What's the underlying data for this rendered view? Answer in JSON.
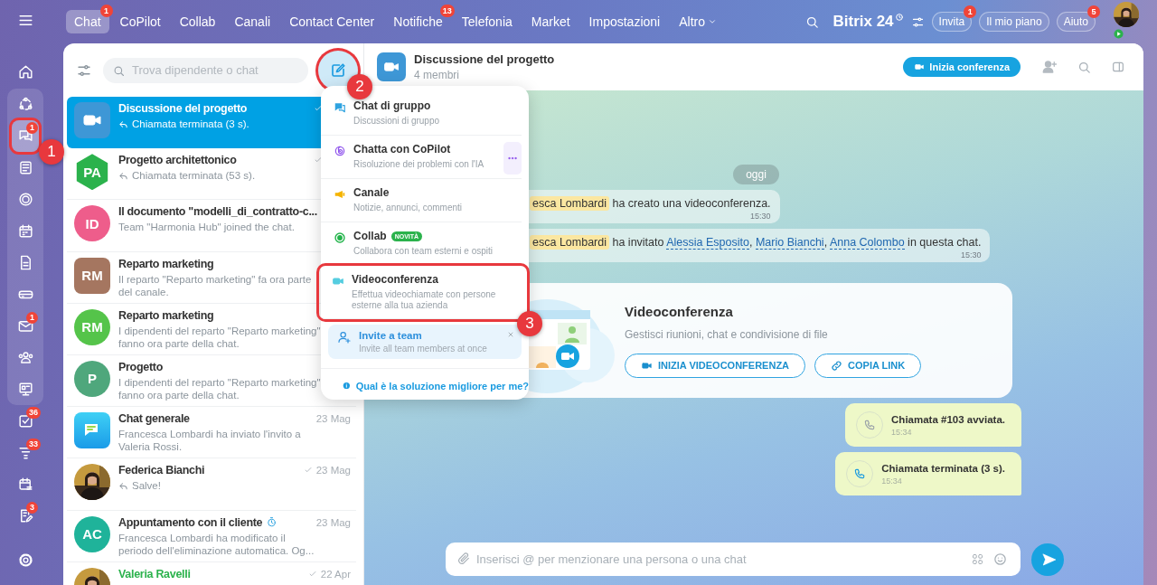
{
  "rail": [
    {
      "selected": false
    },
    {
      "selected": false
    },
    {
      "selected": false
    },
    {
      "selected": true,
      "badge": "1"
    },
    {
      "selected": false
    },
    {
      "selected": false
    },
    {
      "selected": false
    },
    {
      "selected": false
    },
    {
      "selected": false
    },
    {
      "selected": false,
      "badge": "1"
    },
    {
      "selected": false
    },
    {
      "selected": false
    },
    {
      "selected": false,
      "badge": "36"
    },
    {
      "selected": false,
      "badge": "33"
    },
    {
      "selected": false
    },
    {
      "selected": false,
      "badge": "3"
    },
    {
      "selected": false
    }
  ],
  "top_nav": {
    "tabs": [
      {
        "label": "Chat",
        "selected": true,
        "badge": "1"
      },
      {
        "label": "CoPilot",
        "selected": false
      },
      {
        "label": "Collab",
        "selected": false
      },
      {
        "label": "Canali",
        "selected": false
      },
      {
        "label": "Contact Center",
        "selected": false
      },
      {
        "label": "Notifiche",
        "selected": false,
        "badge": "13"
      },
      {
        "label": "Telefonia",
        "selected": false
      },
      {
        "label": "Market",
        "selected": false
      },
      {
        "label": "Impostazioni",
        "selected": false
      },
      {
        "label": "Altro",
        "selected": false,
        "dropdown": true
      }
    ],
    "logo": "Bitrix 24",
    "buttons": [
      {
        "label": "Invita",
        "badge": "1"
      },
      {
        "label": "Il mio piano"
      },
      {
        "label": "Aiuto",
        "badge": "5"
      }
    ]
  },
  "chat_list": {
    "search_placeholder": "Trova dipendente o chat",
    "chats": [
      {
        "title": "Discussione del progetto",
        "subtitle": "Chiamata terminata (3 s).",
        "reply": true,
        "read": true,
        "selected": true,
        "avatar": {
          "kind": "video"
        }
      },
      {
        "title": "Progetto architettonico",
        "subtitle": "Chiamata terminata (53 s).",
        "reply": true,
        "read": true,
        "selected": false,
        "avatar": {
          "kind": "hexagon",
          "initials": "PA",
          "color": "#2bb24c"
        }
      },
      {
        "title": "Il documento \"modelli_di_contratto-c...",
        "subtitle": "Team \"Harmonia Hub\" joined the chat.",
        "reply": false,
        "read": false,
        "selected": false,
        "avatar": {
          "kind": "circle",
          "initials": "ID",
          "color": "#ee5d8b"
        }
      },
      {
        "title": "Reparto marketing",
        "subtitle": "Il reparto \"Reparto marketing\" fa ora parte del canale.",
        "reply": false,
        "read": false,
        "selected": false,
        "avatar": {
          "kind": "square",
          "initials": "RM",
          "color": "#a57660"
        }
      },
      {
        "title": "Reparto marketing",
        "subtitle": "I dipendenti del reparto \"Reparto marketing\" fanno ora parte della chat.",
        "reply": false,
        "read": false,
        "selected": false,
        "avatar": {
          "kind": "circle",
          "initials": "RM",
          "color": "#55c44a"
        }
      },
      {
        "title": "Progetto",
        "subtitle": "I dipendenti del reparto \"Reparto marketing\" fanno ora parte della chat.",
        "reply": false,
        "read": false,
        "selected": false,
        "avatar": {
          "kind": "circle",
          "initials": "P",
          "color": "#4fa77c"
        }
      },
      {
        "title": "Chat generale",
        "subtitle": "Francesca Lombardi ha inviato l'invito a Valeria Rossi.",
        "date": "23 Mag",
        "reply": false,
        "read": false,
        "selected": false,
        "avatar": {
          "kind": "app"
        }
      },
      {
        "title": "Federica Bianchi",
        "subtitle": "Salve!",
        "date": "23 Mag",
        "reply": true,
        "read": true,
        "selected": false
      },
      {
        "title": "Appuntamento con il cliente",
        "autodelete": true,
        "subtitle": "Francesca Lombardi ha modificato il periodo dell'eliminazione automatica. Og...",
        "date": "23 Mag",
        "reply": false,
        "read": false,
        "selected": false,
        "avatar": {
          "kind": "circle",
          "initials": "AC",
          "color": "#1fb39a"
        }
      },
      {
        "title": "Valeria Ravelli",
        "extranet": true,
        "date": "22 Apr",
        "reply": false,
        "read": true,
        "selected": false
      }
    ]
  },
  "new_chat_menu": {
    "items": [
      {
        "title": "Chat di gruppo",
        "subtitle": "Discussioni di gruppo"
      },
      {
        "title": "Chatta con CoPilot",
        "subtitle": "Risoluzione dei problemi con l'IA",
        "more": true
      },
      {
        "title": "Canale",
        "subtitle": "Notizie, annunci, commenti"
      },
      {
        "title": "Collab",
        "badge": "NOVITÀ",
        "subtitle": "Collabora con team esterni e ospiti"
      },
      {
        "title": "Videoconferenza",
        "subtitle": "Effettua videochiamate con persone esterne alla tua azienda"
      }
    ],
    "promo": {
      "title": "Invite a team",
      "subtitle": "Invite all team members at once"
    },
    "help_link": "Qual è la soluzione migliore per me?"
  },
  "chat": {
    "title": "Discussione del progetto",
    "subtitle": "4 membri",
    "call_button": "Inizia conferenza",
    "date_divider": "oggi",
    "system_messages": [
      {
        "parts": [
          {
            "kind": "mention",
            "text": "esca Lombardi"
          },
          {
            "kind": "text",
            "text": " ha creato una videoconferenza."
          }
        ],
        "time": "15:30"
      },
      {
        "parts": [
          {
            "kind": "mention",
            "text": "esca Lombardi"
          },
          {
            "kind": "text",
            "text": " ha invitato "
          },
          {
            "kind": "link",
            "text": "Alessia Esposito"
          },
          {
            "kind": "text",
            "text": ", "
          },
          {
            "kind": "link",
            "text": "Mario Bianchi"
          },
          {
            "kind": "text",
            "text": ", "
          },
          {
            "kind": "link",
            "text": "Anna Colombo"
          },
          {
            "kind": "text",
            "text": " in questa chat."
          }
        ],
        "time": "15:30"
      }
    ],
    "video_card": {
      "title": "Videoconferenza",
      "subtitle": "Gestisci riunioni, chat e condivisione di file",
      "buttons": [
        "INIZIA VIDEOCONFERENZA",
        "COPIA LINK"
      ]
    },
    "calls": [
      {
        "text": "Chiamata #103 avviata.",
        "time": "15:34",
        "active": false
      },
      {
        "text": "Chiamata terminata (3 s).",
        "time": "15:34",
        "active": true
      }
    ],
    "composer_placeholder": "Inserisci @ per menzionare una persona o una chat"
  },
  "tutorial_steps": [
    {
      "number": "1"
    },
    {
      "number": "2"
    },
    {
      "number": "3"
    }
  ]
}
